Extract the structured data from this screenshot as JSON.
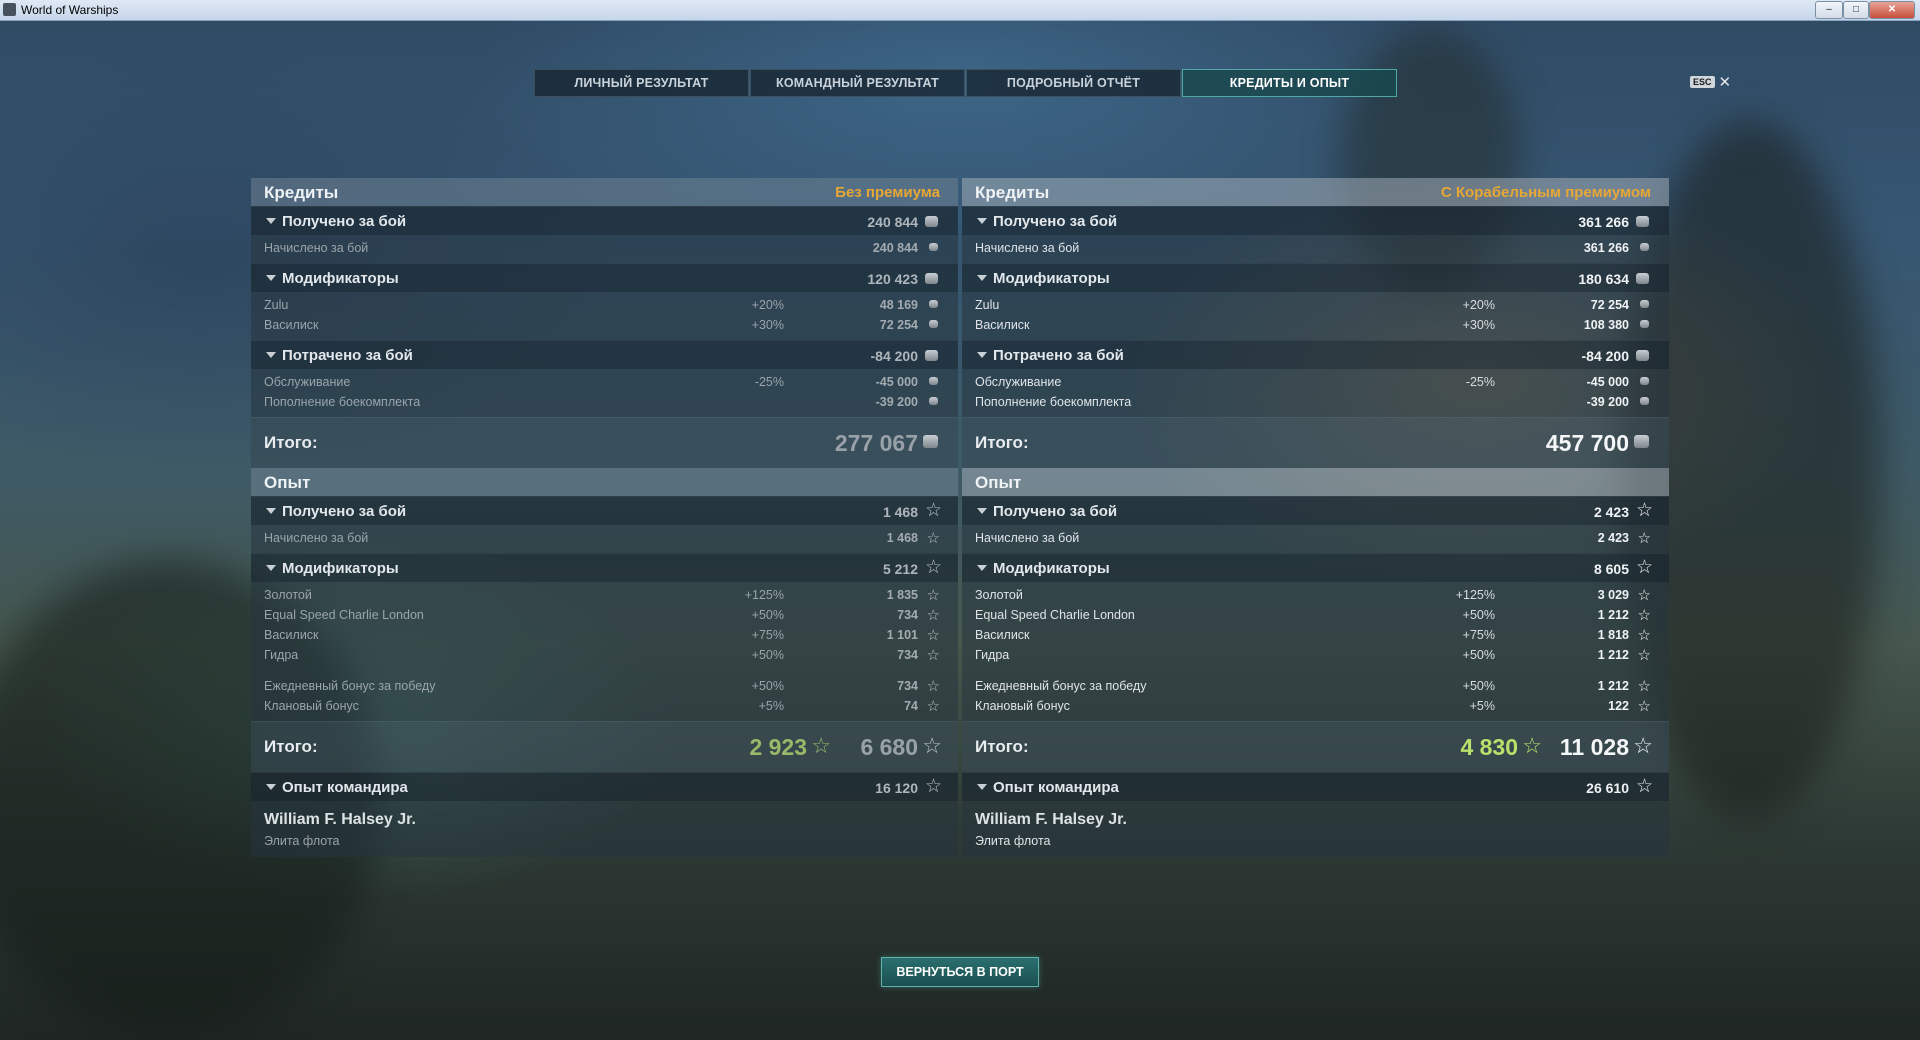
{
  "window": {
    "title": "World of Warships",
    "minimize": "–",
    "maximize": "□",
    "close": "✕"
  },
  "tabs": [
    {
      "label": "ЛИЧНЫЙ РЕЗУЛЬТАТ",
      "active": false
    },
    {
      "label": "КОМАНДНЫЙ РЕЗУЛЬТАТ",
      "active": false
    },
    {
      "label": "ПОДРОБНЫЙ ОТЧЁТ",
      "active": false
    },
    {
      "label": "КРЕДИТЫ И ОПЫТ",
      "active": true
    }
  ],
  "esc": {
    "key": "ESC",
    "close": "✕"
  },
  "colors": {
    "accent": "#e7a735",
    "xp_green": "#b8e06a",
    "tab_active": "#4fa7a6"
  },
  "icons": {
    "coin": "credit-coin-icon",
    "star": "xp-star-icon"
  },
  "left": {
    "credits": {
      "header": "Кредиты",
      "tag": "Без премиума",
      "earned": {
        "label": "Получено за бой",
        "value": "240 844"
      },
      "earned_detail": {
        "name": "Начислено за бой",
        "value": "240 844"
      },
      "mods": {
        "label": "Модификаторы",
        "value": "120 423"
      },
      "mod_rows": [
        {
          "name": "Zulu",
          "pct": "+20%",
          "value": "48 169"
        },
        {
          "name": "Василиск",
          "pct": "+30%",
          "value": "72 254"
        }
      ],
      "spent": {
        "label": "Потрачено за бой",
        "value": "-84 200"
      },
      "spent_rows": [
        {
          "name": "Обслуживание",
          "pct": "-25%",
          "value": "-45 000"
        },
        {
          "name": "Пополнение боекомплекта",
          "pct": "",
          "value": "-39 200"
        }
      ],
      "total": {
        "label": "Итого:",
        "value": "277 067"
      }
    },
    "xp": {
      "header": "Опыт",
      "earned": {
        "label": "Получено за бой",
        "value": "1 468"
      },
      "earned_detail": {
        "name": "Начислено за бой",
        "value": "1 468"
      },
      "mods": {
        "label": "Модификаторы",
        "value": "5 212"
      },
      "mod_rows": [
        {
          "name": "Золотой",
          "pct": "+125%",
          "value": "1 835"
        },
        {
          "name": "Equal Speed Charlie London",
          "pct": "+50%",
          "value": "734"
        },
        {
          "name": "Василиск",
          "pct": "+75%",
          "value": "1 101"
        },
        {
          "name": "Гидра",
          "pct": "+50%",
          "value": "734"
        }
      ],
      "bonus_rows": [
        {
          "name": "Ежедневный бонус за победу",
          "pct": "+50%",
          "value": "734"
        },
        {
          "name": "Клановый бонус",
          "pct": "+5%",
          "value": "74"
        }
      ],
      "total": {
        "label": "Итого:",
        "free": "2 923",
        "value": "6 680"
      },
      "commander": {
        "label": "Опыт командира",
        "value": "16 120",
        "name": "William F. Halsey Jr.",
        "rank": "Элита флота"
      }
    }
  },
  "right": {
    "credits": {
      "header": "Кредиты",
      "tag": "С Корабельным премиумом",
      "earned": {
        "label": "Получено за бой",
        "value": "361 266"
      },
      "earned_detail": {
        "name": "Начислено за бой",
        "value": "361 266"
      },
      "mods": {
        "label": "Модификаторы",
        "value": "180 634"
      },
      "mod_rows": [
        {
          "name": "Zulu",
          "pct": "+20%",
          "value": "72 254"
        },
        {
          "name": "Василиск",
          "pct": "+30%",
          "value": "108 380"
        }
      ],
      "spent": {
        "label": "Потрачено за бой",
        "value": "-84 200"
      },
      "spent_rows": [
        {
          "name": "Обслуживание",
          "pct": "-25%",
          "value": "-45 000"
        },
        {
          "name": "Пополнение боекомплекта",
          "pct": "",
          "value": "-39 200"
        }
      ],
      "total": {
        "label": "Итого:",
        "value": "457 700"
      }
    },
    "xp": {
      "header": "Опыт",
      "earned": {
        "label": "Получено за бой",
        "value": "2 423"
      },
      "earned_detail": {
        "name": "Начислено за бой",
        "value": "2 423"
      },
      "mods": {
        "label": "Модификаторы",
        "value": "8 605"
      },
      "mod_rows": [
        {
          "name": "Золотой",
          "pct": "+125%",
          "value": "3 029"
        },
        {
          "name": "Equal Speed Charlie London",
          "pct": "+50%",
          "value": "1 212"
        },
        {
          "name": "Василиск",
          "pct": "+75%",
          "value": "1 818"
        },
        {
          "name": "Гидра",
          "pct": "+50%",
          "value": "1 212"
        }
      ],
      "bonus_rows": [
        {
          "name": "Ежедневный бонус за победу",
          "pct": "+50%",
          "value": "1 212"
        },
        {
          "name": "Клановый бонус",
          "pct": "+5%",
          "value": "122"
        }
      ],
      "total": {
        "label": "Итого:",
        "free": "4 830",
        "value": "11 028"
      },
      "commander": {
        "label": "Опыт командира",
        "value": "26 610",
        "name": "William F. Halsey Jr.",
        "rank": "Элита флота"
      }
    }
  },
  "footer": {
    "back_button": "ВЕРНУТЬСЯ В ПОРТ"
  }
}
